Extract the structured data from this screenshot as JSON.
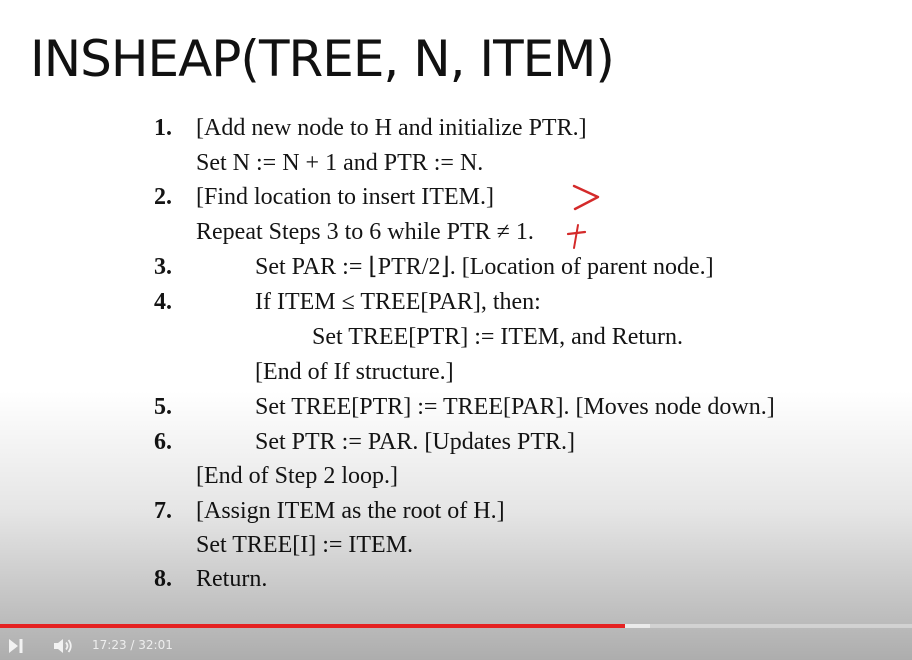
{
  "title": "INSHEAP(TREE, N, ITEM)",
  "algorithm": {
    "lines": [
      {
        "num": "1.",
        "text": "[Add new node to H and initialize PTR.]"
      },
      {
        "num": "",
        "text": "Set N := N + 1 and PTR := N."
      },
      {
        "num": "2.",
        "text": "[Find location to insert ITEM.]"
      },
      {
        "num": "",
        "text": "Repeat Steps 3 to 6 while PTR ≠ 1."
      },
      {
        "num": "3.",
        "text": "Set PAR := ⌊PTR/2⌋. [Location of parent node.]"
      },
      {
        "num": "4.",
        "text": "If ITEM ≤ TREE[PAR], then:"
      },
      {
        "num": "",
        "text": "Set TREE[PTR] := ITEM, and Return."
      },
      {
        "num": "",
        "text": "[End of If structure.]"
      },
      {
        "num": "5.",
        "text": "Set TREE[PTR] := TREE[PAR]. [Moves node down.]"
      },
      {
        "num": "6.",
        "text": "Set PTR := PAR. [Updates PTR.]"
      },
      {
        "num": "",
        "text": "[End of Step 2 loop.]"
      },
      {
        "num": "7.",
        "text": "[Assign ITEM as the root of H.]"
      },
      {
        "num": "",
        "text": "Set TREE[I] := ITEM."
      },
      {
        "num": "8.",
        "text": "Return."
      }
    ]
  },
  "player": {
    "current_time": "17:23",
    "separator": "/",
    "duration": "32:01",
    "time_display": "17:23 / 32:01",
    "played_fraction": 0.685,
    "buffered_fraction": 0.713,
    "colors": {
      "progress": "#e52222",
      "annotation": "#d42a2a"
    },
    "icons": {
      "play": "play-next-icon",
      "volume": "volume-icon"
    }
  }
}
